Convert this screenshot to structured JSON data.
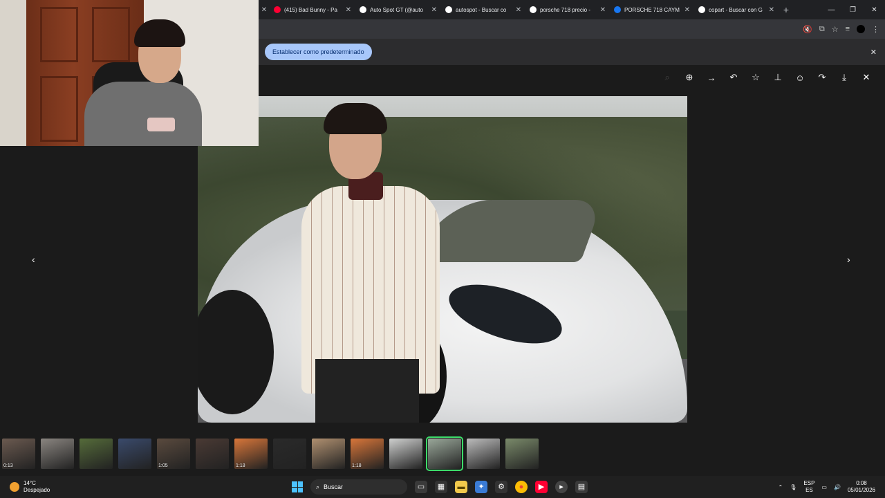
{
  "browser": {
    "tabs": [
      {
        "title": "(415) Bad Bunny - Pa",
        "favicon_color": "#ff0033",
        "icon": "youtube-icon"
      },
      {
        "title": "Auto Spot GT (@auto",
        "favicon_color": "#ffffff",
        "icon": "tiktok-icon"
      },
      {
        "title": "autospot - Buscar co",
        "favicon_color": "#ffffff",
        "icon": "google-icon"
      },
      {
        "title": "porsche 718 precio -",
        "favicon_color": "#ffffff",
        "icon": "google-icon"
      },
      {
        "title": "PORSCHE 718 CAYM",
        "favicon_color": "#1877f2",
        "icon": "facebook-icon"
      },
      {
        "title": "copart - Buscar con G",
        "favicon_color": "#ffffff",
        "icon": "google-icon"
      }
    ],
    "new_tab": "+",
    "close_glyph": "✕"
  },
  "infobar": {
    "set_default_label": "Establecer como predeterminado"
  },
  "viewer": {
    "tools": [
      "zoom-in-icon",
      "forward-arrow-icon",
      "undo-icon",
      "star-icon",
      "pin-icon",
      "emoji-icon",
      "share-icon",
      "download-icon",
      "close-icon"
    ],
    "prev": "‹",
    "next": "›"
  },
  "filmstrip": {
    "thumbs": [
      {
        "duration": "0:13",
        "color": "#6b5a50"
      },
      {
        "duration": "",
        "color": "#8a8580"
      },
      {
        "duration": "",
        "color": "#556b3a"
      },
      {
        "duration": "",
        "color": "#3a4a6b"
      },
      {
        "duration": "1:05",
        "color": "#5a4a3e"
      },
      {
        "duration": "",
        "color": "#4a3a34"
      },
      {
        "duration": "1:18",
        "color": "#d8763a"
      },
      {
        "duration": "",
        "color": "#2a2a2a"
      },
      {
        "duration": "",
        "color": "#b09070"
      },
      {
        "duration": "1:18",
        "color": "#d8763a"
      },
      {
        "duration": "",
        "color": "#cfd0cf"
      },
      {
        "duration": "",
        "color": "#9aa89a",
        "selected": true
      },
      {
        "duration": "",
        "color": "#bcbcbc"
      },
      {
        "duration": "",
        "color": "#7a8a6a"
      }
    ]
  },
  "taskbar": {
    "temperature": "14°C",
    "condition": "Despejado",
    "search_label": "Buscar",
    "lang_top": "ESP",
    "lang_bottom": "ES",
    "time": "0:08",
    "date": "05/01/2026"
  }
}
